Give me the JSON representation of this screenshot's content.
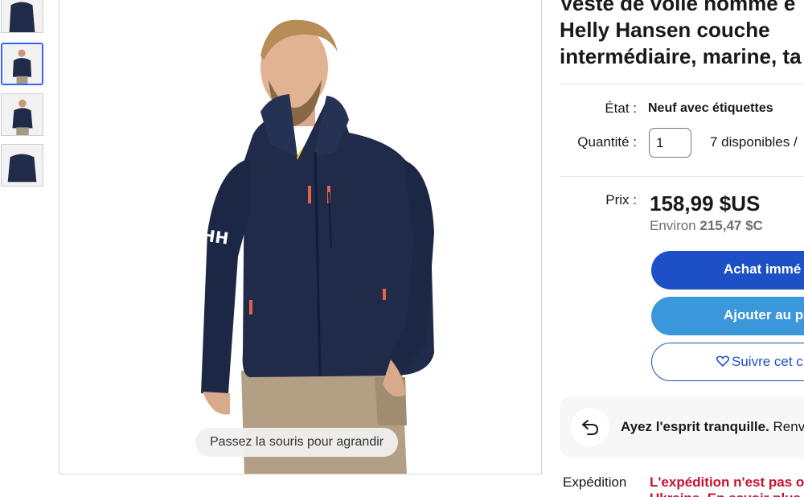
{
  "product": {
    "title": "Veste de voile homme e\nHelly Hansen couche\nintermédiaire, marine, ta",
    "zoom_hint": "Passez la souris pour agrandir",
    "thumbnails": [
      {
        "name": "thumbnail-1",
        "selected": false
      },
      {
        "name": "thumbnail-2",
        "selected": true
      },
      {
        "name": "thumbnail-3",
        "selected": false
      },
      {
        "name": "thumbnail-4",
        "selected": false
      }
    ]
  },
  "details": {
    "condition_label": "État :",
    "condition_value": "Neuf avec étiquettes",
    "quantity_label": "Quantité :",
    "quantity_value": "1",
    "availability": "7 disponibles /"
  },
  "pricing": {
    "price_label": "Prix :",
    "price": "158,99 $US",
    "approx_prefix": "Environ",
    "approx_value": "215,47 $C"
  },
  "actions": {
    "buy_now": "Achat immé",
    "add_to_cart": "Ajouter au pa",
    "watch": "Suivre cet c"
  },
  "reassurance": {
    "bold": "Ayez l'esprit tranquille.",
    "rest": " Renv"
  },
  "shipping": {
    "label": "Expédition",
    "line1": "L'expédition n'est pas o",
    "line2": "Ukraine. En savoir plus"
  },
  "colors": {
    "buy_button": "#1d4fc7",
    "cart_button": "#3a97d9",
    "link_blue": "#1d4fc7",
    "shipping_red": "#c8102e",
    "jacket_navy": "#1f2b49"
  }
}
